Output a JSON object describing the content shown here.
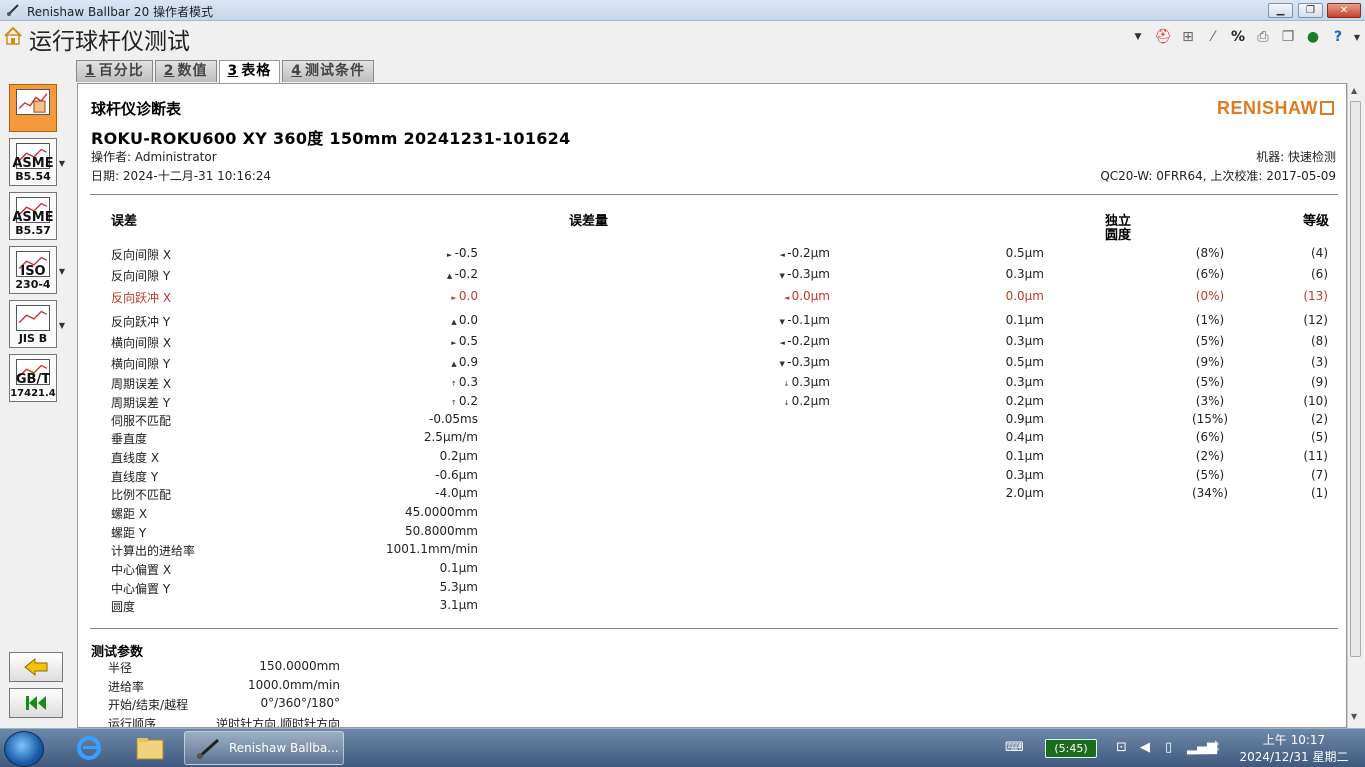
{
  "window": {
    "title": "Renishaw Ballbar 20 操作者模式"
  },
  "app": {
    "title": "运行球杆仪测试"
  },
  "tabs": [
    {
      "num": "1",
      "label": "百分比"
    },
    {
      "num": "2",
      "label": "数值"
    },
    {
      "num": "3",
      "label": "表格"
    },
    {
      "num": "4",
      "label": "测试条件"
    }
  ],
  "sidebar": {
    "buttons": [
      {
        "label": "",
        "label2": ""
      },
      {
        "label": "ASME",
        "label2": "B5.54"
      },
      {
        "label": "ASME",
        "label2": "B5.57"
      },
      {
        "label": "ISO",
        "label2": "230-4"
      },
      {
        "label": "",
        "label2": "JIS B"
      },
      {
        "label": "GB/T",
        "label2": "17421.4"
      }
    ]
  },
  "report": {
    "title": "球杆仪诊断表",
    "subtitle": "ROKU-ROKU600 XY 360度  150mm 20241231-101624",
    "logo": "RENISHAW",
    "operator": "操作者: Administrator",
    "date": "日期: 2024-十二月-31 10:16:24",
    "machine": "机器: 快速检测",
    "qc": "QC20-W: 0FRR64, 上次校准: 2017-05-09",
    "headers": {
      "error": "误差",
      "amount": "误差量",
      "indep": "独立",
      "roundness": "圆度",
      "rank": "等级"
    },
    "rows": [
      {
        "name": "反向间隙  X",
        "a1": "►",
        "v1": "-0.5",
        "a2": "◄",
        "v2": "-0.2μm",
        "v3": "0.5μm",
        "v4": "(8%)",
        "v5": "(4)",
        "red": false
      },
      {
        "name": "反向间隙  Y",
        "a1": "▲",
        "v1": "-0.2",
        "a2": "▼",
        "v2": "-0.3μm",
        "v3": "0.3μm",
        "v4": "(6%)",
        "v5": "(6)",
        "red": false
      },
      {
        "name": "反向跃冲  X",
        "a1": "►",
        "v1": "0.0",
        "a2": "◄",
        "v2": "0.0μm",
        "v3": "0.0μm",
        "v4": "(0%)",
        "v5": "(13)",
        "red": true
      },
      {
        "name": "反向跃冲  Y",
        "a1": "▲",
        "v1": "0.0",
        "a2": "▼",
        "v2": "-0.1μm",
        "v3": "0.1μm",
        "v4": "(1%)",
        "v5": "(12)",
        "red": false
      },
      {
        "name": "横向间隙  X",
        "a1": "►",
        "v1": "0.5",
        "a2": "◄",
        "v2": "-0.2μm",
        "v3": "0.3μm",
        "v4": "(5%)",
        "v5": "(8)",
        "red": false
      },
      {
        "name": "横向间隙  Y",
        "a1": "▲",
        "v1": "0.9",
        "a2": "▼",
        "v2": "-0.3μm",
        "v3": "0.5μm",
        "v4": "(9%)",
        "v5": "(3)",
        "red": false
      },
      {
        "name": "周期误差  X",
        "a1": "↑",
        "v1": "0.3",
        "a2": "↓",
        "v2": "0.3μm",
        "v3": "0.3μm",
        "v4": "(5%)",
        "v5": "(9)",
        "red": false
      },
      {
        "name": "周期误差  Y",
        "a1": "↑",
        "v1": "0.2",
        "a2": "↓",
        "v2": "0.2μm",
        "v3": "0.2μm",
        "v4": "(3%)",
        "v5": "(10)",
        "red": false
      },
      {
        "name": "伺服不匹配",
        "a1": "",
        "v1": "-0.05ms",
        "a2": "",
        "v2": "",
        "v3": "0.9μm",
        "v4": "(15%)",
        "v5": "(2)",
        "red": false
      },
      {
        "name": "垂直度",
        "a1": "",
        "v1": "2.5μm/m",
        "a2": "",
        "v2": "",
        "v3": "0.4μm",
        "v4": "(6%)",
        "v5": "(5)",
        "red": false
      },
      {
        "name": "直线度  X",
        "a1": "",
        "v1": "0.2μm",
        "a2": "",
        "v2": "",
        "v3": "0.1μm",
        "v4": "(2%)",
        "v5": "(11)",
        "red": false
      },
      {
        "name": "直线度  Y",
        "a1": "",
        "v1": "-0.6μm",
        "a2": "",
        "v2": "",
        "v3": "0.3μm",
        "v4": "(5%)",
        "v5": "(7)",
        "red": false
      },
      {
        "name": "比例不匹配",
        "a1": "",
        "v1": "-4.0μm",
        "a2": "",
        "v2": "",
        "v3": "2.0μm",
        "v4": "(34%)",
        "v5": "(1)",
        "red": false
      },
      {
        "name": "螺距  X",
        "a1": "",
        "v1": "45.0000mm",
        "a2": "",
        "v2": "",
        "v3": "",
        "v4": "",
        "v5": "",
        "red": false
      },
      {
        "name": "螺距  Y",
        "a1": "",
        "v1": "50.8000mm",
        "a2": "",
        "v2": "",
        "v3": "",
        "v4": "",
        "v5": "",
        "red": false
      },
      {
        "name": "计算出的进给率",
        "a1": "",
        "v1": "1001.1mm/min",
        "a2": "",
        "v2": "",
        "v3": "",
        "v4": "",
        "v5": "",
        "red": false
      },
      {
        "name": "中心偏置  X",
        "a1": "",
        "v1": "0.1μm",
        "a2": "",
        "v2": "",
        "v3": "",
        "v4": "",
        "v5": "",
        "red": false
      },
      {
        "name": "中心偏置  Y",
        "a1": "",
        "v1": "5.3μm",
        "a2": "",
        "v2": "",
        "v3": "",
        "v4": "",
        "v5": "",
        "red": false
      },
      {
        "name": "圆度",
        "a1": "",
        "v1": "3.1μm",
        "a2": "",
        "v2": "",
        "v3": "",
        "v4": "",
        "v5": "",
        "red": false
      }
    ],
    "params_title": "测试参数",
    "params": [
      {
        "label": "半径",
        "value": "150.0000mm"
      },
      {
        "label": "进给率",
        "value": "1000.0mm/min"
      },
      {
        "label": "开始/结束/越程",
        "value": "0°/360°/180°"
      },
      {
        "label": "运行顺序",
        "value": "逆时针方向,顺时针方向"
      }
    ]
  },
  "taskbar": {
    "task_label": "Renishaw Ballba...",
    "battery": "(5:45)",
    "time": "上午 10:17",
    "date": "2024/12/31 星期二"
  },
  "colors": {
    "accent": "#f49a3c",
    "logo": "#e07a1f",
    "error_red": "#c0392b"
  }
}
